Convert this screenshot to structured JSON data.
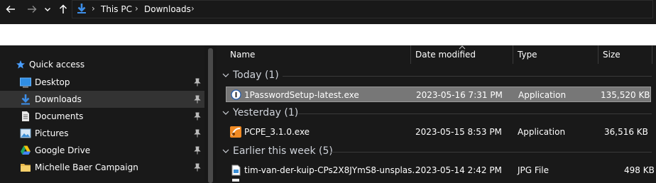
{
  "addressbar": {
    "breadcrumbs": [
      "This PC",
      "Downloads"
    ]
  },
  "sidebar": {
    "items": [
      {
        "label": "Quick access",
        "icon": "star-icon"
      },
      {
        "label": "Desktop",
        "icon": "desktop-icon",
        "pinned": true
      },
      {
        "label": "Downloads",
        "icon": "download-icon",
        "pinned": true,
        "selected": true
      },
      {
        "label": "Documents",
        "icon": "document-icon",
        "pinned": true
      },
      {
        "label": "Pictures",
        "icon": "pictures-icon",
        "pinned": true
      },
      {
        "label": "Google Drive",
        "icon": "google-drive-icon",
        "pinned": true
      },
      {
        "label": "Michelle Baer Campaign",
        "icon": "folder-icon",
        "pinned": true
      }
    ]
  },
  "columns": {
    "name": "Name",
    "date": "Date modified",
    "type": "Type",
    "size": "Size"
  },
  "groups": [
    {
      "label": "Today (1)",
      "files": [
        {
          "name": "1PasswordSetup-latest.exe",
          "date": "2023-05-16 7:31 PM",
          "type": "Application",
          "size": "135,520 KB",
          "icon": "onepassword-icon",
          "selected": true
        }
      ]
    },
    {
      "label": "Yesterday (1)",
      "files": [
        {
          "name": "PCPE_3.1.0.exe",
          "date": "2023-05-15 8:53 PM",
          "type": "Application",
          "size": "36,516 KB",
          "icon": "pcpe-app-icon"
        }
      ]
    },
    {
      "label": "Earlier this week (5)",
      "files": [
        {
          "name": "tim-van-der-kuip-CPs2X8JYmS8-unsplas...",
          "date": "2023-05-14 2:42 PM",
          "type": "JPG File",
          "size": "498 KB",
          "icon": "image-file-icon"
        }
      ]
    }
  ],
  "colors": {
    "background": "#191919",
    "selection": "#777777",
    "accent": "#4a9eff"
  }
}
